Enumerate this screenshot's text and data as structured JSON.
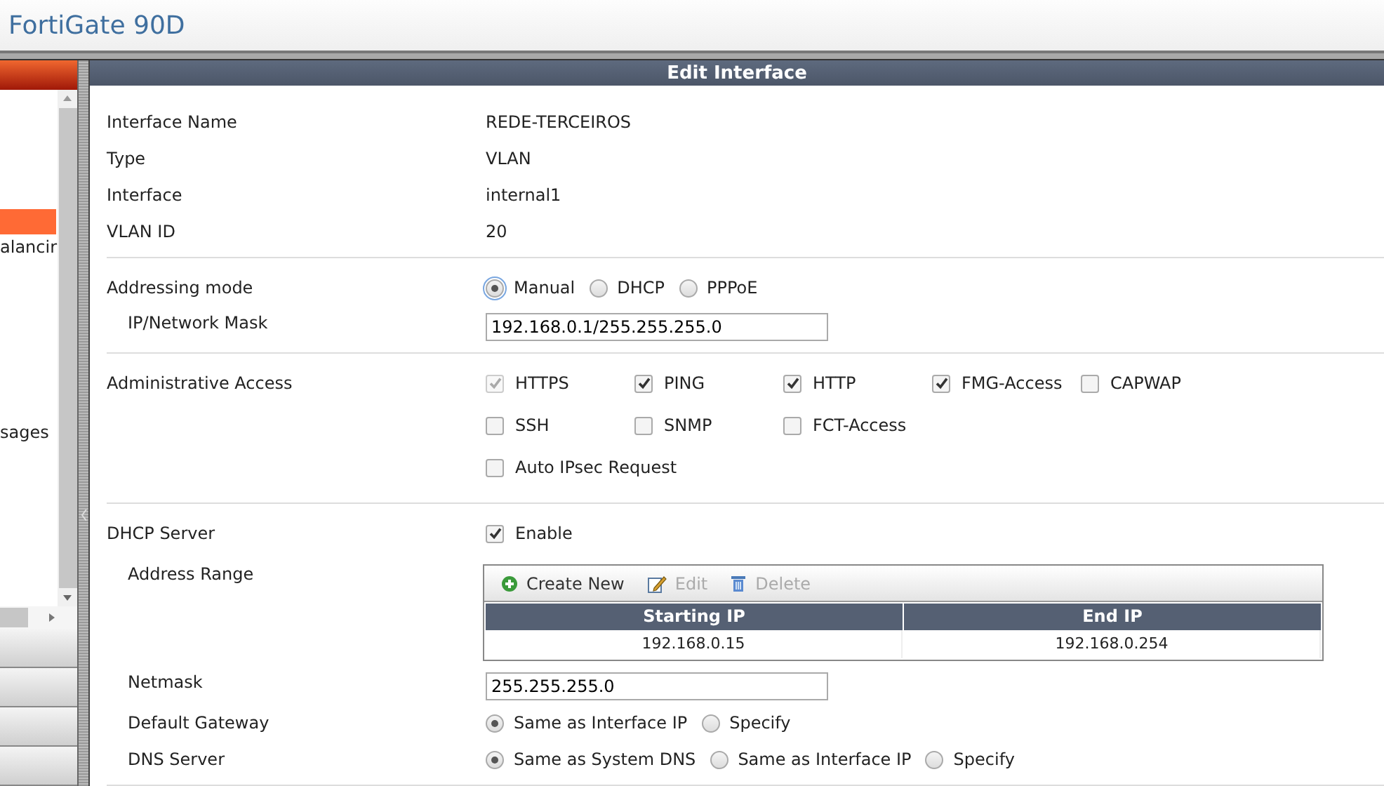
{
  "header": {
    "title": "FortiGate 90D"
  },
  "sidebar": {
    "items": [
      {
        "selected": true
      },
      {
        "label": "alancir",
        "selected": false
      },
      {
        "label": "sages",
        "selected": false
      }
    ]
  },
  "panel": {
    "title": "Edit Interface",
    "sections": [
      {
        "rows": [
          {
            "kind": "text",
            "label": "Interface Name",
            "value": "REDE-TERCEIROS"
          },
          {
            "kind": "text",
            "label": "Type",
            "value": "VLAN"
          },
          {
            "kind": "text",
            "label": "Interface",
            "value": "internal1"
          },
          {
            "kind": "text",
            "label": "VLAN ID",
            "value": "20"
          }
        ]
      },
      {
        "rows": [
          {
            "kind": "radio",
            "label": "Addressing mode",
            "options": [
              {
                "label": "Manual",
                "selected": true
              },
              {
                "label": "DHCP",
                "selected": false
              },
              {
                "label": "PPPoE",
                "selected": false
              }
            ],
            "children": [
              {
                "kind": "input",
                "label": "IP/Network Mask",
                "value": "192.168.0.1/255.255.255.0"
              }
            ]
          }
        ]
      },
      {
        "rows": [
          {
            "kind": "checkboxes",
            "label": "Administrative Access",
            "lines": [
              [
                {
                  "label": "HTTPS",
                  "checked": true,
                  "disabled": true
                },
                {
                  "label": "PING",
                  "checked": true,
                  "disabled": false
                },
                {
                  "label": "HTTP",
                  "checked": true,
                  "disabled": false
                },
                {
                  "label": "FMG-Access",
                  "checked": true,
                  "disabled": false
                },
                {
                  "label": "CAPWAP",
                  "checked": false,
                  "disabled": false
                }
              ],
              [
                {
                  "label": "SSH",
                  "checked": false,
                  "disabled": false
                },
                {
                  "label": "SNMP",
                  "checked": false,
                  "disabled": false
                },
                {
                  "label": "FCT-Access",
                  "checked": false,
                  "disabled": false
                }
              ],
              [
                {
                  "label": "Auto IPsec Request",
                  "checked": false,
                  "disabled": false
                }
              ]
            ]
          }
        ]
      },
      {
        "rows": [
          {
            "kind": "checkboxes",
            "label": "DHCP Server",
            "lines": [
              [
                {
                  "label": "Enable",
                  "checked": true,
                  "disabled": false
                }
              ]
            ],
            "children": [
              {
                "kind": "table",
                "label": "Address Range",
                "toolbar": [
                  {
                    "kind": "create",
                    "label": "Create New",
                    "disabled": false
                  },
                  {
                    "kind": "edit",
                    "label": "Edit",
                    "disabled": true
                  },
                  {
                    "kind": "delete",
                    "label": "Delete",
                    "disabled": true
                  }
                ],
                "columns": [
                  "Starting IP",
                  "End IP"
                ],
                "rows": [
                  [
                    "192.168.0.15",
                    "192.168.0.254"
                  ]
                ]
              },
              {
                "kind": "input",
                "label": "Netmask",
                "value": "255.255.255.0"
              },
              {
                "kind": "radio",
                "label": "Default Gateway",
                "options": [
                  {
                    "label": "Same as Interface IP",
                    "selected": true
                  },
                  {
                    "label": "Specify",
                    "selected": false
                  }
                ]
              },
              {
                "kind": "radio",
                "label": "DNS Server",
                "options": [
                  {
                    "label": "Same as System DNS",
                    "selected": true
                  },
                  {
                    "label": "Same as Interface IP",
                    "selected": false
                  },
                  {
                    "label": "Specify",
                    "selected": false
                  }
                ]
              }
            ]
          }
        ]
      }
    ]
  }
}
